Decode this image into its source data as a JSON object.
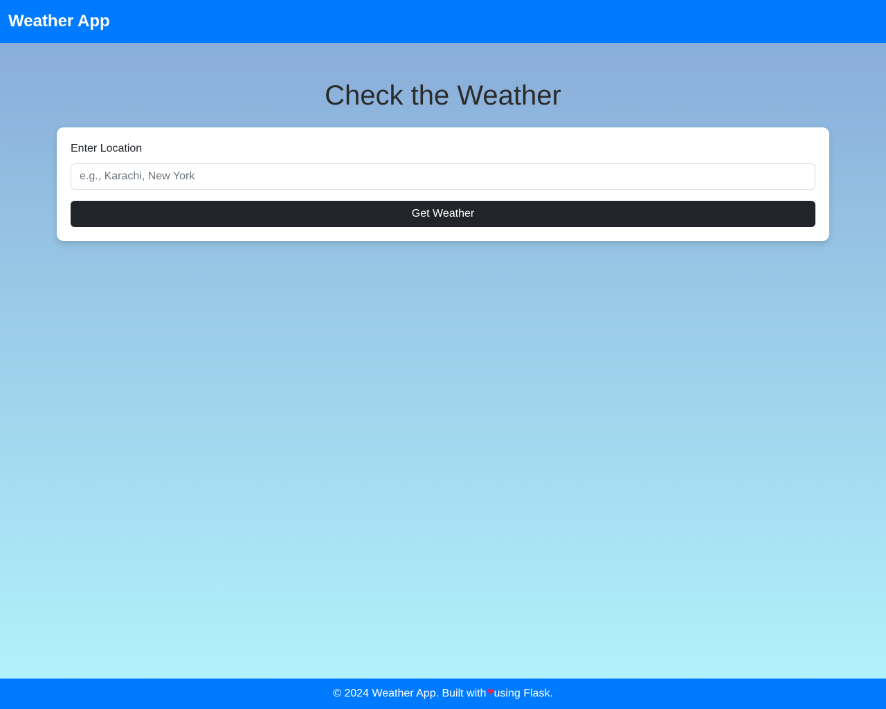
{
  "navbar": {
    "brand": "Weather App"
  },
  "main": {
    "title": "Check the Weather"
  },
  "form": {
    "label": "Enter Location",
    "input_value": "",
    "input_placeholder": "e.g., Karachi, New York",
    "submit_label": "Get Weather"
  },
  "footer": {
    "text_before": "© 2024 Weather App. Built with",
    "heart_icon": "heart-icon",
    "text_after": "using Flask."
  },
  "colors": {
    "primary": "#007bff",
    "button_dark": "#212529",
    "heart": "#e0245e"
  }
}
